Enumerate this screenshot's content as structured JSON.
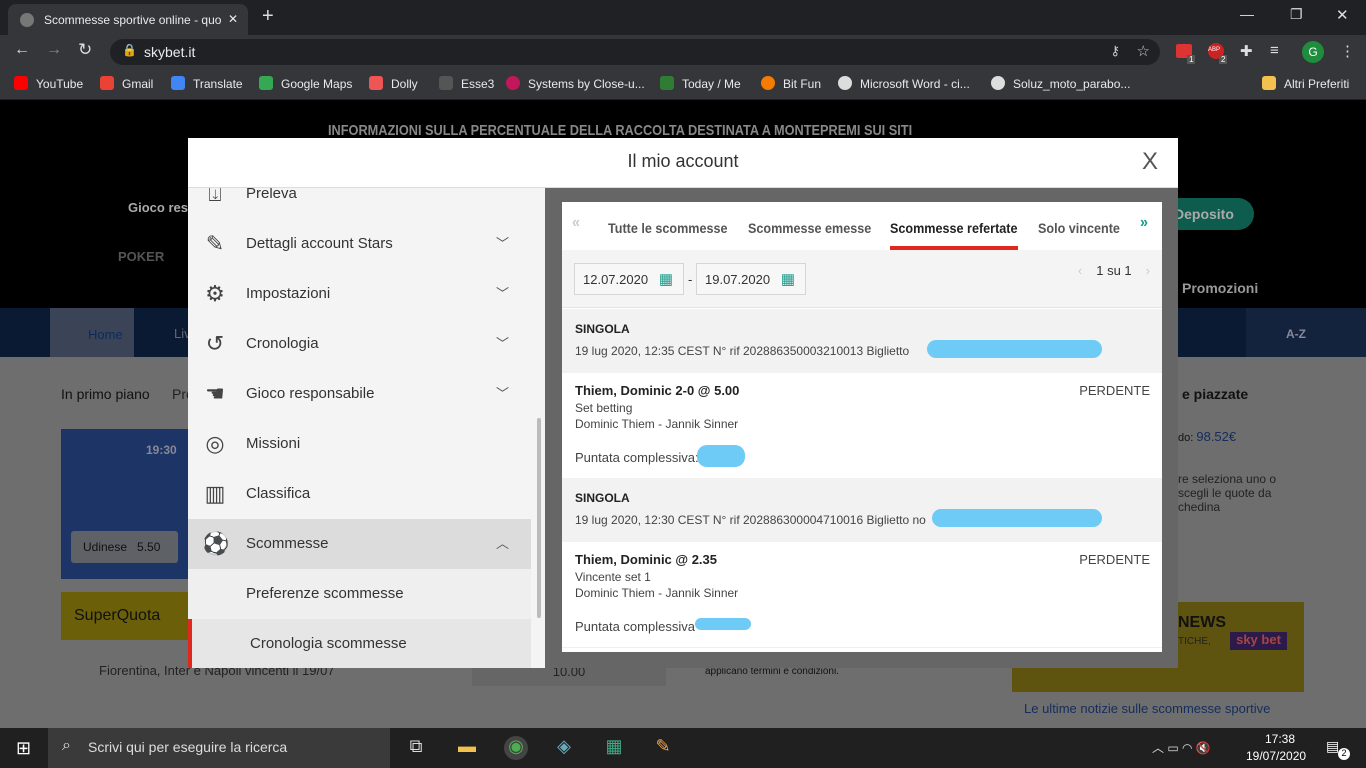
{
  "browser": {
    "tab_title": "Scommesse sportive online - quo",
    "url": "skybet.it",
    "bookmarks": [
      "YouTube",
      "Gmail",
      "Translate",
      "Google Maps",
      "Dolly",
      "Esse3",
      "Systems by Close-u...",
      "Today / Me",
      "Bit Fun",
      "Microsoft Word - ci...",
      "Soluz_moto_parabo...",
      "Altri Preferiti"
    ],
    "profile_initial": "G",
    "ext_badges": [
      "1",
      "2"
    ]
  },
  "background": {
    "banner": "INFORMAZIONI SULLA PERCENTUALE DELLA RACCOLTA DESTINATA A MONTEPREMI SUI SITI",
    "gioco": "Gioco res",
    "poker": "POKER",
    "deposit": "Deposito",
    "promo": "Promozioni",
    "home": "Home",
    "live": "Liv",
    "az": "A-Z",
    "in_primo_piano": "In primo piano",
    "pro": "Pro",
    "time": "19:30",
    "udinese": "Udinese",
    "udinese_odds": "5.50",
    "superquota": "SuperQuota",
    "fiorentina": "Fiorentina, Inter e Napoli vincenti il 19/07",
    "odds_10": "10.00",
    "terms": "applicano termini e condizioni.",
    "piazzate": "e piazzate",
    "saldo_label": "do:",
    "saldo": "98.52€",
    "hint": "re seleziona uno o scegli le quote da chedina",
    "news": "NEWS",
    "tiche": "TICHE,",
    "latest": "Le ultime notizie sulle scommesse sportive"
  },
  "modal": {
    "title": "Il mio account",
    "close": "X",
    "menu": [
      {
        "label": "Preleva",
        "icon": "withdraw-icon"
      },
      {
        "label": "Dettagli account Stars",
        "icon": "pencil-icon",
        "expand": true
      },
      {
        "label": "Impostazioni",
        "icon": "gear-icon",
        "expand": true
      },
      {
        "label": "Cronologia",
        "icon": "history-icon",
        "expand": true
      },
      {
        "label": "Gioco responsabile",
        "icon": "hand-icon",
        "expand": true
      },
      {
        "label": "Missioni",
        "icon": "target-icon"
      },
      {
        "label": "Classifica",
        "icon": "bar-chart-icon"
      },
      {
        "label": "Scommesse",
        "icon": "soccer-ball-icon",
        "expanded": true
      },
      {
        "label": "Preferenze scommesse"
      },
      {
        "label": "Cronologia scommesse",
        "active": true
      }
    ],
    "tabs": [
      "Tutte le scommesse",
      "Scommesse emesse",
      "Scommesse refertate",
      "Solo vincente"
    ],
    "active_tab": "Scommesse refertate",
    "date_from": "12.07.2020",
    "date_sep": "-",
    "date_to": "19.07.2020",
    "pagination": "1 su 1",
    "bets": [
      {
        "type": "SINGOLA",
        "meta": "19 lug 2020, 12:35 CEST   N° rif 202886350003210013 Biglietto",
        "selection": "Thiem, Dominic 2-0 @ 5.00",
        "market": "Set betting",
        "event": "Dominic Thiem - Jannik Sinner",
        "stake_label": "Puntata complessiva:",
        "result": "PERDENTE"
      },
      {
        "type": "SINGOLA",
        "meta": "19 lug 2020, 12:30 CEST   N° rif 202886300004710016 Biglietto no",
        "selection": "Thiem, Dominic @ 2.35",
        "market": "Vincente set 1",
        "event": "Dominic Thiem - Jannik Sinner",
        "stake_label": "Puntata complessiva",
        "result": "PERDENTE"
      }
    ]
  },
  "taskbar": {
    "search": "Scrivi qui per eseguire la ricerca",
    "time": "17:38",
    "date": "19/07/2020",
    "notif": "2"
  },
  "colors": {
    "accent": "#e0281e",
    "teal": "#159a88",
    "redaction": "#6ecbf6"
  }
}
